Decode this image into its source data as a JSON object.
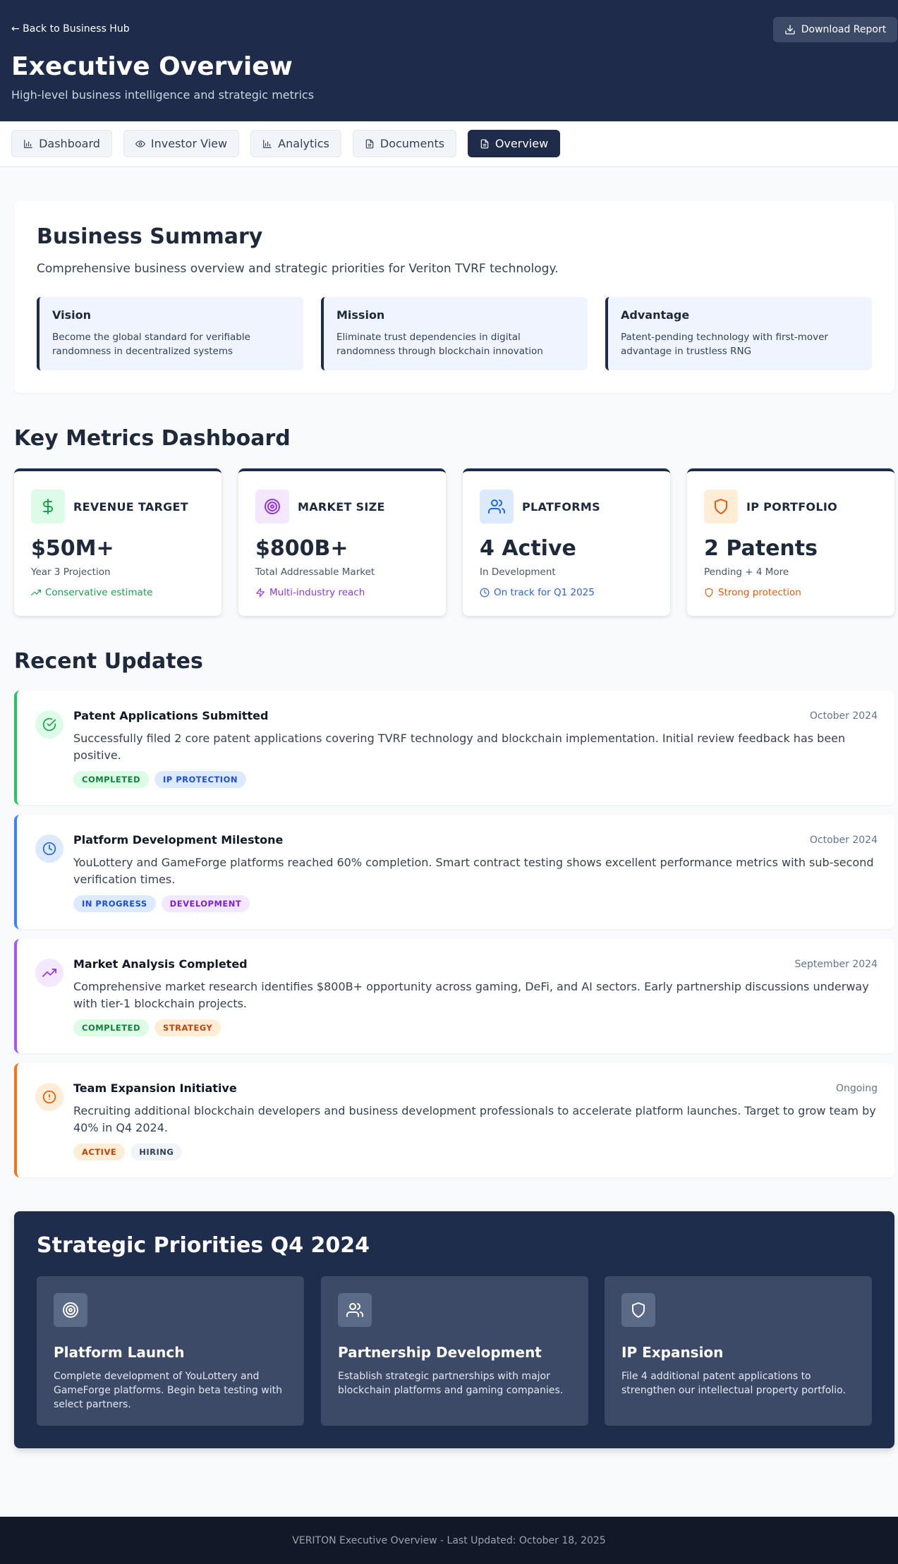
{
  "header": {
    "back_link": "← Back to Business Hub",
    "download_label": "Download Report",
    "title": "Executive Overview",
    "subtitle": "High-level business intelligence and strategic metrics"
  },
  "tabs": [
    {
      "label": "Dashboard",
      "icon": "bar-chart-icon"
    },
    {
      "label": "Investor View",
      "icon": "eye-icon"
    },
    {
      "label": "Analytics",
      "icon": "bar-chart-icon"
    },
    {
      "label": "Documents",
      "icon": "document-icon"
    },
    {
      "label": "Overview",
      "icon": "document-icon",
      "active": true
    }
  ],
  "summary": {
    "title": "Business Summary",
    "description": "Comprehensive business overview and strategic priorities for Veriton TVRF technology.",
    "pillars": [
      {
        "title": "Vision",
        "text": "Become the global standard for verifiable randomness in decentralized systems"
      },
      {
        "title": "Mission",
        "text": "Eliminate trust dependencies in digital randomness through blockchain innovation"
      },
      {
        "title": "Advantage",
        "text": "Patent-pending technology with first-mover advantage in trustless RNG"
      }
    ]
  },
  "metrics_section": {
    "title": "Key Metrics Dashboard",
    "cards": [
      {
        "label": "REVENUE TARGET",
        "value": "$50M+",
        "sub": "Year 3 Projection",
        "note": "Conservative estimate",
        "icon": "dollar-icon",
        "color": "#16a34a",
        "bg": "#dcfce7"
      },
      {
        "label": "MARKET SIZE",
        "value": "$800B+",
        "sub": "Total Addressable Market",
        "note": "Multi-industry reach",
        "icon": "target-icon",
        "color": "#9333ea",
        "bg": "#f3e8ff"
      },
      {
        "label": "PLATFORMS",
        "value": "4 Active",
        "sub": "In Development",
        "note": "On track for Q1 2025",
        "icon": "users-icon",
        "color": "#2563eb",
        "bg": "#dbeafe"
      },
      {
        "label": "IP PORTFOLIO",
        "value": "2 Patents",
        "sub": "Pending + 4 More",
        "note": "Strong protection",
        "icon": "shield-icon",
        "color": "#ea580c",
        "bg": "#ffedd5"
      }
    ]
  },
  "updates_section": {
    "title": "Recent Updates",
    "items": [
      {
        "title": "Patent Applications Submitted",
        "date": "October 2024",
        "text": "Successfully filed 2 core patent applications covering TVRF technology and blockchain implementation. Initial review feedback has been positive.",
        "tags": [
          "COMPLETED",
          "IP PROTECTION"
        ],
        "icon": "check-circle-icon",
        "accent": "#22c55e"
      },
      {
        "title": "Platform Development Milestone",
        "date": "October 2024",
        "text": "YouLottery and GameForge platforms reached 60% completion. Smart contract testing shows excellent performance metrics with sub-second verification times.",
        "tags": [
          "IN PROGRESS",
          "DEVELOPMENT"
        ],
        "icon": "clock-icon",
        "accent": "#3b82f6"
      },
      {
        "title": "Market Analysis Completed",
        "date": "September 2024",
        "text": "Comprehensive market research identifies $800B+ opportunity across gaming, DeFi, and AI sectors. Early partnership discussions underway with tier-1 blockchain projects.",
        "tags": [
          "COMPLETED",
          "STRATEGY"
        ],
        "icon": "trending-up-icon",
        "accent": "#a855f7"
      },
      {
        "title": "Team Expansion Initiative",
        "date": "Ongoing",
        "text": "Recruiting additional blockchain developers and business development professionals to accelerate platform launches. Target to grow team by 40% in Q4 2024.",
        "tags": [
          "ACTIVE",
          "HIRING"
        ],
        "icon": "alert-circle-icon",
        "accent": "#f97316"
      }
    ]
  },
  "strategy": {
    "title": "Strategic Priorities Q4 2024",
    "items": [
      {
        "title": "Platform Launch",
        "text": "Complete development of YouLottery and GameForge platforms. Begin beta testing with select partners.",
        "icon": "target-icon"
      },
      {
        "title": "Partnership Development",
        "text": "Establish strategic partnerships with major blockchain platforms and gaming companies.",
        "icon": "users-icon"
      },
      {
        "title": "IP Expansion",
        "text": "File 4 additional patent applications to strengthen our intellectual property portfolio.",
        "icon": "shield-icon"
      }
    ]
  },
  "footer": {
    "text": "VERITON Executive Overview - Last Updated: October 18, 2025"
  }
}
